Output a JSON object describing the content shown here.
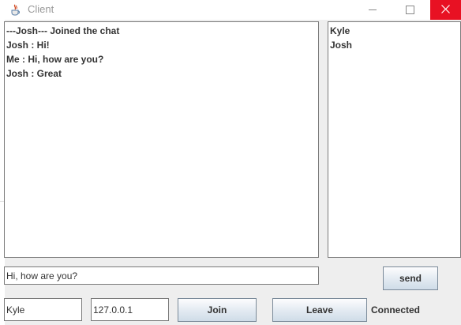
{
  "window": {
    "title": "Client",
    "app_icon": "java-cup-icon"
  },
  "title_buttons": {
    "minimize_icon": "minimize-icon",
    "maximize_icon": "maximize-icon",
    "close_icon": "close-icon",
    "close_color": "#e81123"
  },
  "chat": {
    "messages": [
      "---Josh--- Joined the chat",
      "Josh : Hi!",
      "Me : Hi, how are you?",
      "Josh : Great"
    ]
  },
  "users": {
    "items": [
      "Kyle",
      "Josh"
    ]
  },
  "compose": {
    "message_value": "Hi, how are you?",
    "send_label": "send"
  },
  "connection": {
    "name_value": "Kyle",
    "ip_value": "127.0.0.1",
    "join_label": "Join",
    "leave_label": "Leave",
    "status": "Connected"
  }
}
